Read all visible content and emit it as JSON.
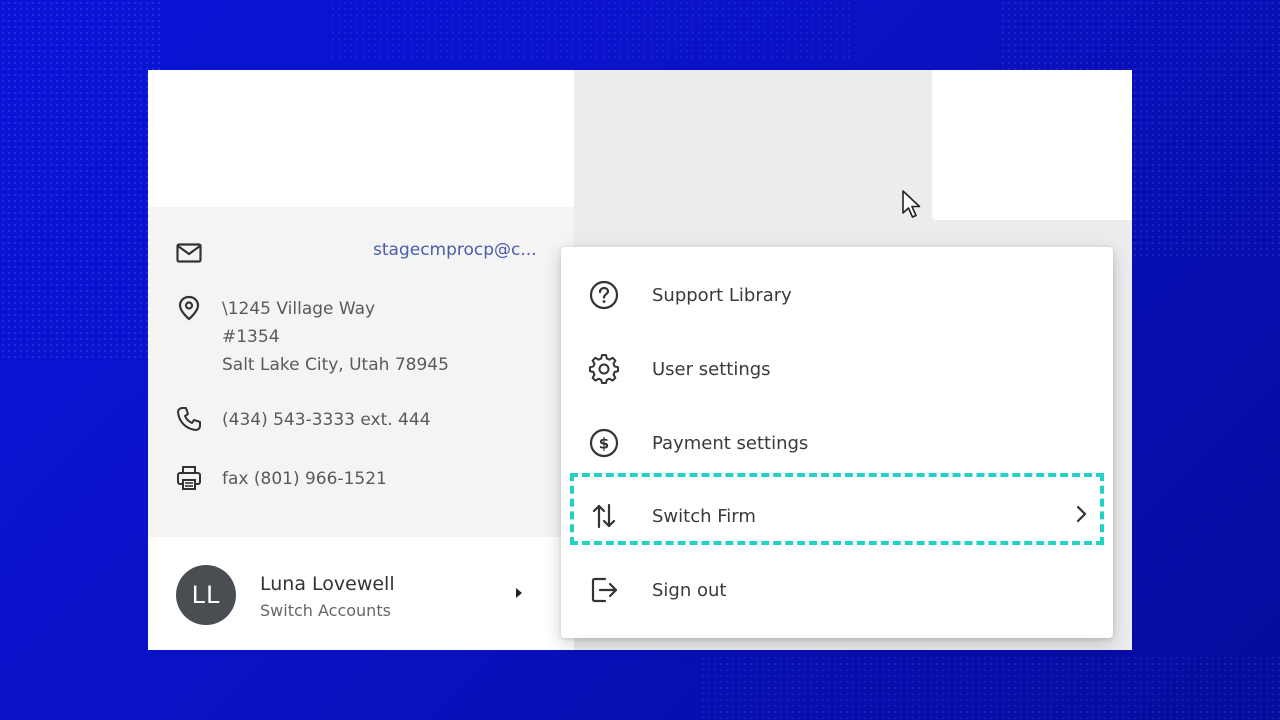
{
  "contact": {
    "email": "stagecmprocp@c...",
    "address_line1": "\\1245 Village Way",
    "address_line2": "#1354",
    "address_line3": "Salt Lake City, Utah 78945",
    "phone": "(434) 543-3333 ext. 444",
    "fax": "fax (801) 966-1521"
  },
  "account": {
    "initials": "LL",
    "name": "Luna Lovewell",
    "sub": "Switch Accounts"
  },
  "menu": {
    "items": [
      {
        "label": "Support Library",
        "icon": "help-circle-icon"
      },
      {
        "label": "User settings",
        "icon": "gear-icon"
      },
      {
        "label": "Payment settings",
        "icon": "dollar-circle-icon"
      },
      {
        "label": "Switch Firm",
        "icon": "swap-vertical-icon",
        "has_submenu": true,
        "highlighted": true
      },
      {
        "label": "Sign out",
        "icon": "sign-out-icon"
      }
    ]
  },
  "colors": {
    "background": "#0a14d8",
    "highlight": "#22d3c5",
    "email_link": "#4a5da8",
    "avatar": "#4a4d52"
  }
}
